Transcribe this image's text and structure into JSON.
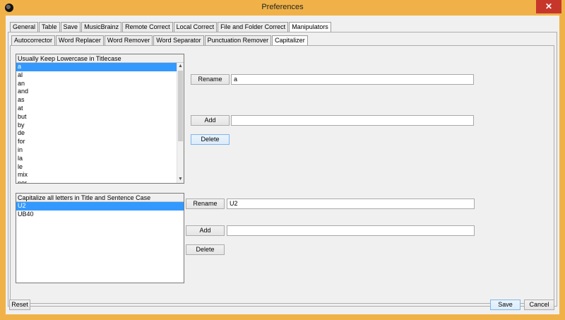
{
  "window": {
    "title": "Preferences",
    "close_glyph": "✕"
  },
  "main_tabs": [
    "General",
    "Table",
    "Save",
    "MusicBrainz",
    "Remote Correct",
    "Local Correct",
    "File and Folder Correct",
    "Manipulators"
  ],
  "sub_tabs": [
    "Autocorrector",
    "Word Replacer",
    "Word Remover",
    "Word Separator",
    "Punctuation Remover",
    "Capitalizer"
  ],
  "lowercase_section": {
    "header": "Usually Keep Lowercase in Titlecase",
    "items": [
      "a",
      "al",
      "an",
      "and",
      "as",
      "at",
      "but",
      "by",
      "de",
      "for",
      "in",
      "la",
      "le",
      "mix",
      "nor"
    ],
    "selected_index": 0,
    "rename_label": "Rename",
    "rename_value": "a",
    "add_label": "Add",
    "add_value": "",
    "delete_label": "Delete"
  },
  "uppercase_section": {
    "header": "Capitalize all letters in Title and Sentence Case",
    "items": [
      "U2",
      "UB40"
    ],
    "selected_index": 0,
    "rename_label": "Rename",
    "rename_value": "U2",
    "add_label": "Add",
    "add_value": "",
    "delete_label": "Delete"
  },
  "footer": {
    "reset_label": "Reset",
    "save_label": "Save",
    "cancel_label": "Cancel"
  },
  "icons": {
    "scroll_up": "▲",
    "scroll_down": "▼"
  },
  "colors": {
    "title_bar": "#f0b248",
    "close_button": "#c7362b",
    "selection": "#3399ff"
  }
}
